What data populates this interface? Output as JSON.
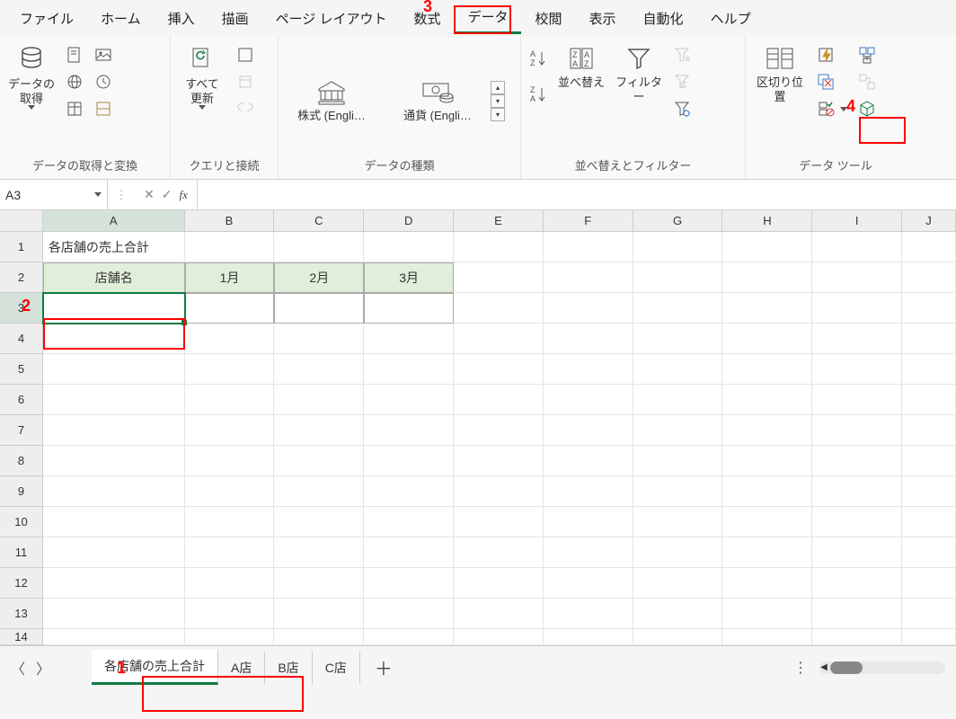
{
  "menu": {
    "file": "ファイル",
    "home": "ホーム",
    "insert": "挿入",
    "draw": "描画",
    "pagelayout": "ページ レイアウト",
    "formulas": "数式",
    "data": "データ",
    "review": "校閲",
    "view": "表示",
    "automate": "自動化",
    "help": "ヘルプ"
  },
  "ribbon": {
    "group1": {
      "get_data": "データの\n取得",
      "label": "データの取得と変換"
    },
    "group2": {
      "refresh": "すべて\n更新",
      "label": "クエリと接続"
    },
    "group3": {
      "stocks": "株式 (Engli…",
      "currency": "通貨 (Engli…",
      "label": "データの種類"
    },
    "group4": {
      "sort": "並べ替え",
      "filter": "フィルター",
      "label": "並べ替えとフィルター"
    },
    "group5": {
      "texttocols": "区切り位置",
      "label": "データ ツール"
    }
  },
  "namebox": "A3",
  "formula": "",
  "columns": [
    "A",
    "B",
    "C",
    "D",
    "E",
    "F",
    "G",
    "H",
    "I",
    "J"
  ],
  "rows": [
    "1",
    "2",
    "3",
    "4",
    "5",
    "6",
    "7",
    "8",
    "9",
    "10",
    "11",
    "12",
    "13",
    "14"
  ],
  "cells": {
    "A1": "各店舗の売上合計",
    "A2": "店舗名",
    "B2": "1月",
    "C2": "2月",
    "D2": "3月"
  },
  "sheets": {
    "s1": "各店舗の売上合計",
    "s2": "A店",
    "s3": "B店",
    "s4": "C店"
  },
  "annotations": {
    "n1": "1",
    "n2": "2",
    "n3": "3",
    "n4": "4"
  }
}
